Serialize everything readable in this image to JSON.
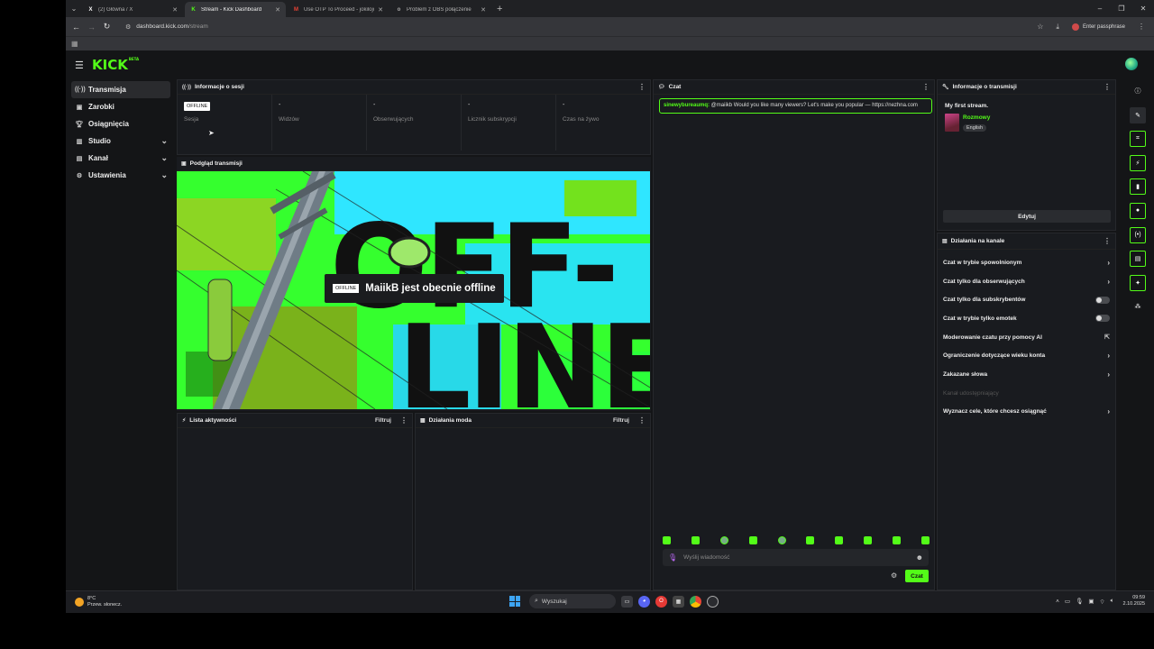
{
  "browser": {
    "tabs": [
      {
        "label": "(2) Główna / X",
        "favicon": "X",
        "active": false
      },
      {
        "label": "Stream - Kick Dashboard",
        "favicon": "K",
        "active": true
      },
      {
        "label": "Use OTP To Proceed - jokilojocker",
        "favicon": "M",
        "active": false
      },
      {
        "label": "Problem z OBS połączenie",
        "favicon": "o",
        "active": false
      }
    ],
    "url": "dashboard.kick.com/stream",
    "url_host": "dashboard.kick.com",
    "url_path": "/stream",
    "passphrase_label": "Enter passphrase"
  },
  "app": {
    "logo": "KICK",
    "logo_badge": "BETA",
    "accent": "#53fc18"
  },
  "sidebar": {
    "items": [
      {
        "label": "Transmisja",
        "icon": "broadcast-icon",
        "active": true
      },
      {
        "label": "Zarobki",
        "icon": "wallet-icon"
      },
      {
        "label": "Osiągnięcia",
        "icon": "trophy-icon"
      },
      {
        "label": "Studio",
        "icon": "studio-icon",
        "expandable": true
      },
      {
        "label": "Kanał",
        "icon": "channel-icon",
        "expandable": true
      },
      {
        "label": "Ustawienia",
        "icon": "gear-icon",
        "expandable": true
      }
    ]
  },
  "session": {
    "title": "Informacje o sesji",
    "status_badge": "OFFLINE",
    "cells": [
      {
        "value": "",
        "label": "Sesja"
      },
      {
        "value": "-",
        "label": "Widzów"
      },
      {
        "value": "-",
        "label": "Obserwujących"
      },
      {
        "value": "-",
        "label": "Licznik subskrypcji"
      },
      {
        "value": "-",
        "label": "Czas na żywo"
      }
    ]
  },
  "preview": {
    "title": "Podgląd transmisji",
    "badge": "OFFLINE",
    "message": "MaiikB jest obecnie offline",
    "art_text": [
      "OFF-",
      "LINE"
    ]
  },
  "activity": {
    "title": "Lista aktywności",
    "filter": "Filtruj"
  },
  "mod": {
    "title": "Działania moda",
    "filter": "Filtruj"
  },
  "chat": {
    "title": "Czat",
    "message_user": "sinewybureaumq:",
    "message_text": " @maiikb Would you like many viewers? Let's make you popular — https://nezhna.com",
    "input_placeholder": "Wyślij wiadomość",
    "send_label": "Czat",
    "emote_count": 10
  },
  "stream_info": {
    "title": "Informacje o transmisji",
    "stream_title": "My first stream.",
    "category": "Rozmowy",
    "language": "English",
    "edit_label": "Edytuj"
  },
  "channel_actions": {
    "title": "Działania na kanale",
    "items": [
      {
        "label": "Czat w trybie spowolnionym",
        "control": "chevron"
      },
      {
        "label": "Czat tylko dla obserwujących",
        "control": "chevron"
      },
      {
        "label": "Czat tylko dla subskrybentów",
        "control": "toggle",
        "on": false
      },
      {
        "label": "Czat w trybie tylko emotek",
        "control": "toggle",
        "on": false
      },
      {
        "label": "Moderowanie czatu przy pomocy AI",
        "control": "external"
      },
      {
        "label": "Ograniczenie dotyczące wieku konta",
        "control": "chevron"
      },
      {
        "label": "Zakazane słowa",
        "control": "chevron"
      },
      {
        "label": "Kanał udostępniający",
        "control": "none",
        "disabled": true
      },
      {
        "label": "Wyznacz cele, które chcesz osiągnąć",
        "control": "chevron"
      }
    ]
  },
  "rail": {
    "icons": [
      "info-icon",
      "pencil-icon",
      "scan-icon",
      "bolt-icon",
      "note-icon",
      "chat-bubble-icon",
      "broadcast-icon",
      "layout-icon",
      "wrench-icon",
      "share-icon"
    ]
  },
  "taskbar": {
    "temperature": "8°C",
    "weather": "Przew. słonecz.",
    "search_label": "Wyszukaj",
    "time": "09:59",
    "date": "2.10.2025"
  }
}
